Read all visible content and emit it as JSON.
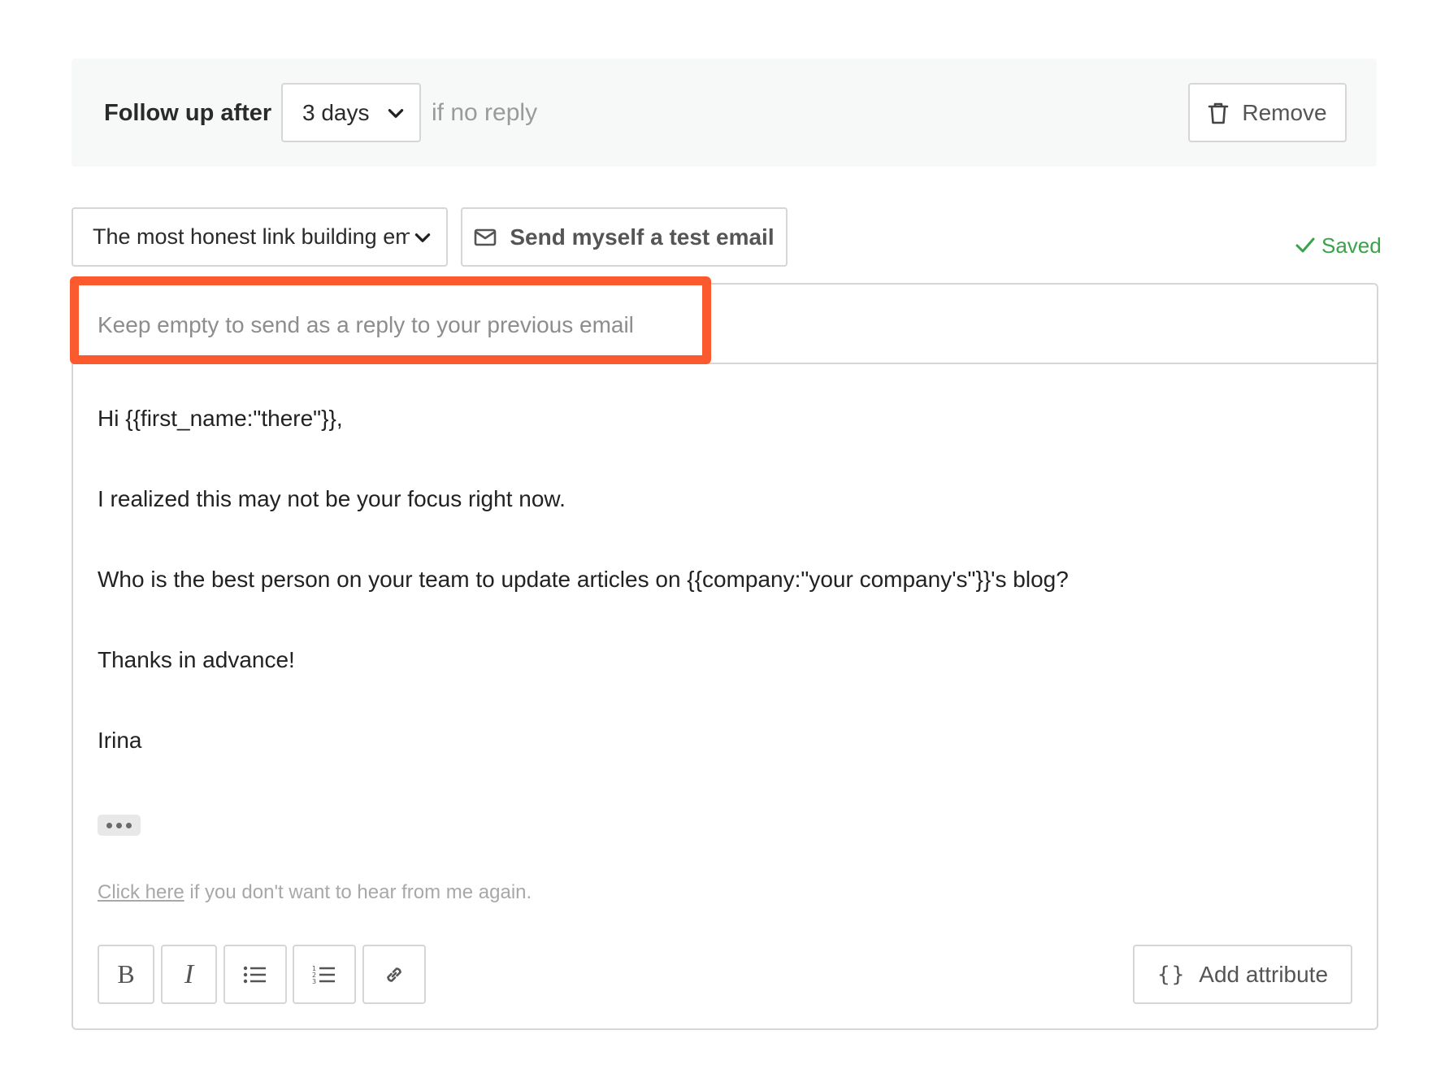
{
  "followup": {
    "label": "Follow up after",
    "delay_value": "3 days",
    "condition": "if no reply",
    "remove_label": "Remove"
  },
  "template": {
    "selected": "The most honest link building email",
    "test_email_label": "Send myself a test email",
    "status": "Saved"
  },
  "editor": {
    "subject_value": "",
    "subject_placeholder": "Keep empty to send as a reply to your previous email",
    "body": [
      "Hi {{first_name:\"there\"}},",
      "I realized this may not be your focus right now.",
      "Who is the best person on your team to update articles on {{company:\"your company's\"}}'s blog?",
      "Thanks in advance!",
      "Irina"
    ],
    "unsubscribe_link": "Click here",
    "unsubscribe_text": " if you don't want to hear from me again.",
    "toolbar": {
      "bold": "B",
      "italic": "I",
      "add_attribute_label": "Add attribute",
      "add_attribute_icon": "{}"
    }
  },
  "colors": {
    "highlight": "#fb5a2e",
    "saved": "#3aa24a",
    "border": "#d6d6d6"
  },
  "icons": [
    "chevron-down-icon",
    "trash-icon",
    "envelope-icon",
    "check-icon",
    "ellipsis-icon",
    "bullet-list-icon",
    "numbered-list-icon",
    "link-icon",
    "braces-icon"
  ]
}
